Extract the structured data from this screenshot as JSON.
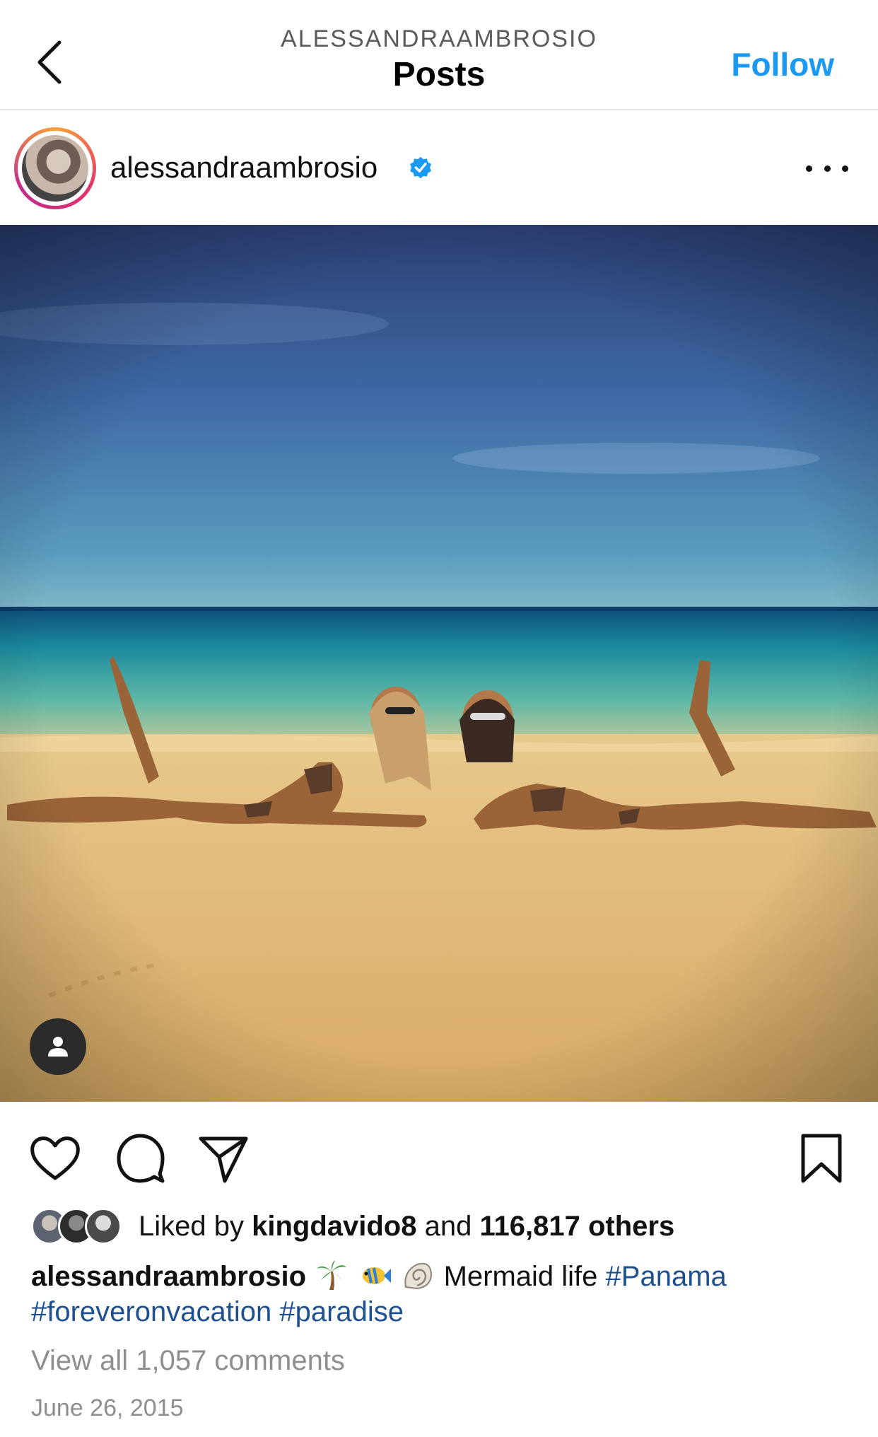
{
  "header": {
    "subtitle": "ALESSANDRAAMBROSIO",
    "title": "Posts",
    "follow_label": "Follow"
  },
  "post": {
    "author": "alessandraambrosio",
    "verified": true,
    "likes": {
      "prefix": "Liked by",
      "user": "kingdavido8",
      "joiner": "and",
      "others": "116,817 others"
    },
    "caption": {
      "user": "alessandraambrosio",
      "emojis": [
        "palm-tree",
        "tropical-fish",
        "spiral-shell"
      ],
      "text": "Mermaid life",
      "hashtags": [
        "#Panama",
        "#foreveronvacation",
        "#paradise"
      ]
    },
    "view_comments": "View all 1,057 comments",
    "date": "June 26, 2015"
  },
  "colors": {
    "accent": "#1a9af2",
    "hashtag": "#1e4f8f",
    "muted": "#8e8e8e"
  },
  "icons": [
    "chevron-left-icon",
    "verified-badge-icon",
    "more-horizontal-icon",
    "user-tag-icon",
    "heart-icon",
    "comment-icon",
    "share-icon",
    "bookmark-icon"
  ]
}
